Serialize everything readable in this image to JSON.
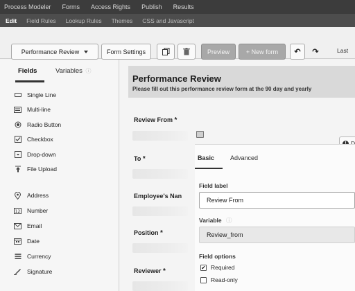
{
  "top_nav": {
    "items": [
      "Process Modeler",
      "Forms",
      "Access Rights",
      "Publish",
      "Results"
    ]
  },
  "sub_nav": {
    "items": [
      "Edit",
      "Field Rules",
      "Lookup Rules",
      "Themes",
      "CSS and Javascript"
    ]
  },
  "toolbar": {
    "form_select": "Performance Review",
    "form_settings": "Form Settings",
    "preview": "Preview",
    "new_form": "+ New form",
    "last": "Last"
  },
  "sidebar": {
    "tabs": [
      "Fields",
      "Variables"
    ],
    "fields": [
      {
        "label": "Single Line",
        "icon": "single-line-icon"
      },
      {
        "label": "Multi-line",
        "icon": "multi-line-icon"
      },
      {
        "label": "Radio Button",
        "icon": "radio-icon"
      },
      {
        "label": "Checkbox",
        "icon": "checkbox-icon"
      },
      {
        "label": "Drop-down",
        "icon": "dropdown-icon"
      },
      {
        "label": "File Upload",
        "icon": "upload-icon"
      },
      {
        "label": "Address",
        "icon": "pin-icon"
      },
      {
        "label": "Number",
        "icon": "number-icon"
      },
      {
        "label": "Email",
        "icon": "email-icon"
      },
      {
        "label": "Date",
        "icon": "date-icon"
      },
      {
        "label": "Currency",
        "icon": "currency-icon"
      },
      {
        "label": "Signature",
        "icon": "signature-icon"
      }
    ]
  },
  "form": {
    "title": "Performance Review",
    "description": "Please fill out this performance review form at the 90 day and yearly",
    "fields": [
      {
        "label": "Review From",
        "required": "*"
      },
      {
        "label": "To",
        "required": "*"
      },
      {
        "label": "Employee's Nan",
        "required": ""
      },
      {
        "label": "Position",
        "required": "*"
      },
      {
        "label": "Reviewer",
        "required": "*"
      }
    ]
  },
  "properties": {
    "tabs": [
      "Basic",
      "Advanced"
    ],
    "field_label_heading": "Field label",
    "field_label_value": "Review From",
    "variable_heading": "Variable",
    "variable_value": "Review_from",
    "field_options_heading": "Field options",
    "options": [
      {
        "label": "Required",
        "checked": true
      },
      {
        "label": "Read-only",
        "checked": false
      }
    ],
    "side_button": "D"
  }
}
